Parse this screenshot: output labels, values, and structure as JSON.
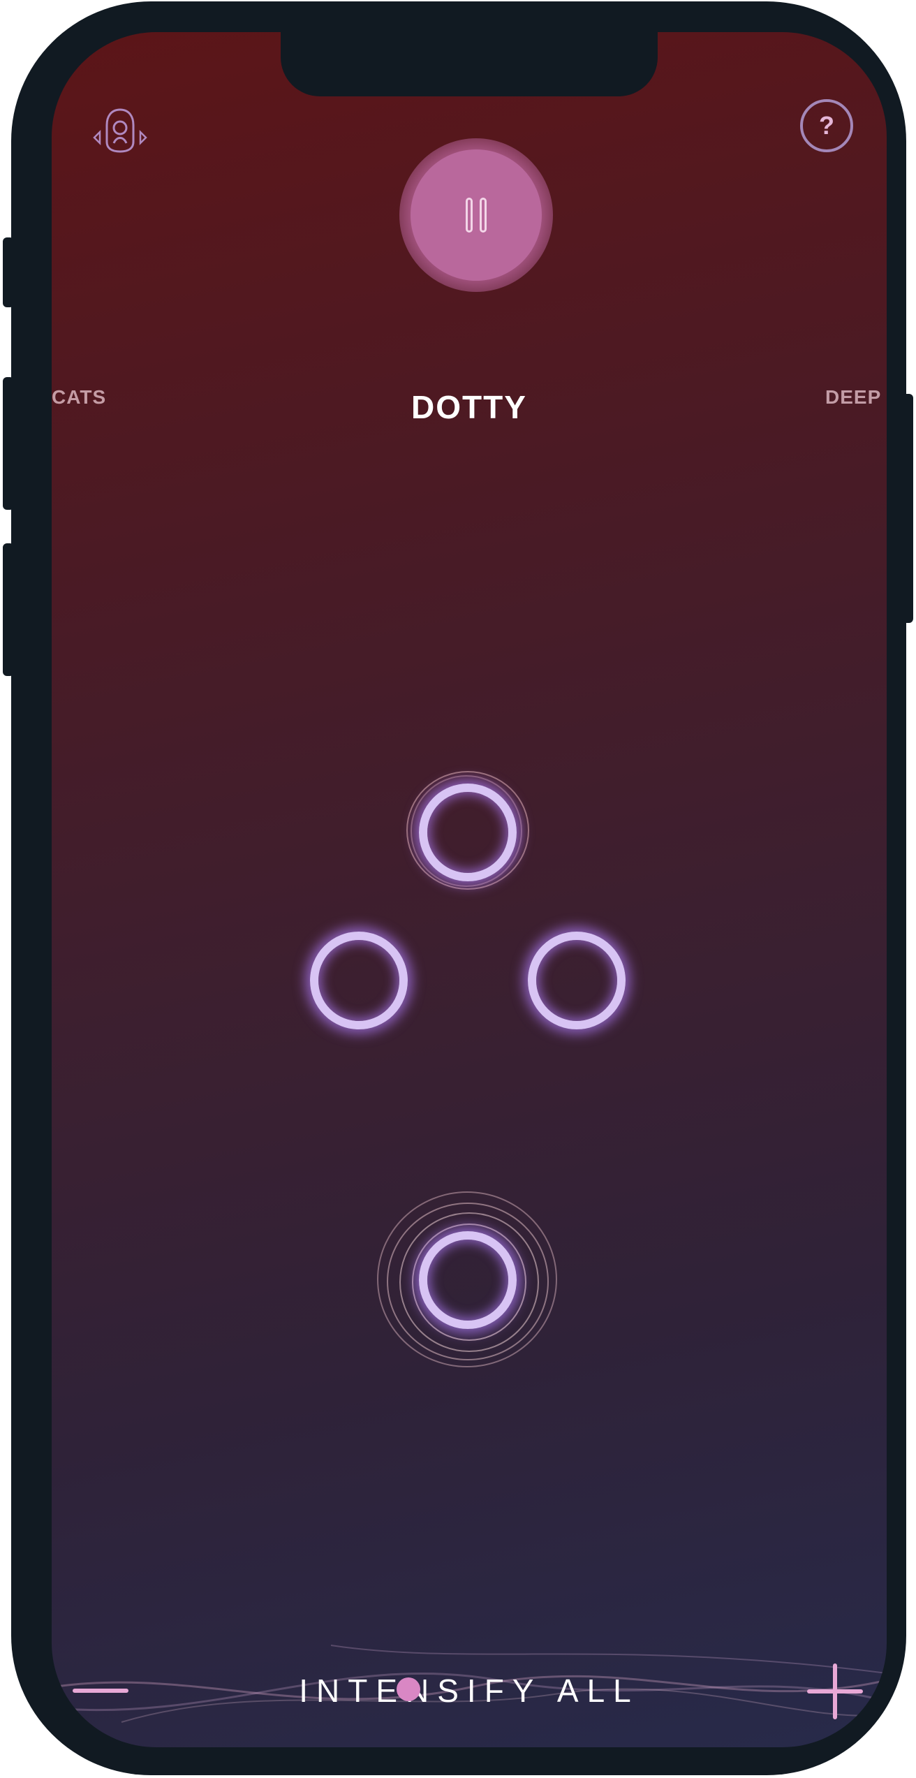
{
  "header": {
    "left_icon": "cat-head-icon",
    "help_label": "?"
  },
  "player": {
    "pause_icon": "pause-icon"
  },
  "carousel": {
    "prev": "CATS",
    "current": "DOTTY",
    "next": "DEEP"
  },
  "footer": {
    "minus_icon": "minus-icon",
    "plus_icon": "plus-icon",
    "label": "INTENSIFY ALL"
  },
  "colors": {
    "accent_pink": "#e8a8d6",
    "dot_ring": "#d8c4f4",
    "pause_button": "#b9689c"
  }
}
